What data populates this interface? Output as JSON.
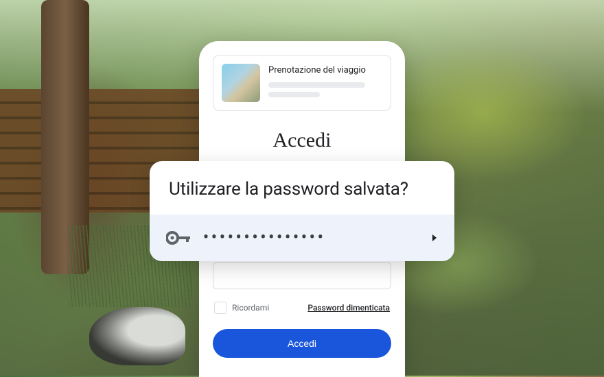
{
  "booking": {
    "title": "Prenotazione del viaggio"
  },
  "signin": {
    "heading": "Accedi",
    "remember_label": "Ricordami",
    "forgot_link": "Password dimenticata",
    "button_label": "Accedi"
  },
  "password_prompt": {
    "title": "Utilizzare la password salvata?",
    "masked_value": "•••••••••••••••"
  }
}
